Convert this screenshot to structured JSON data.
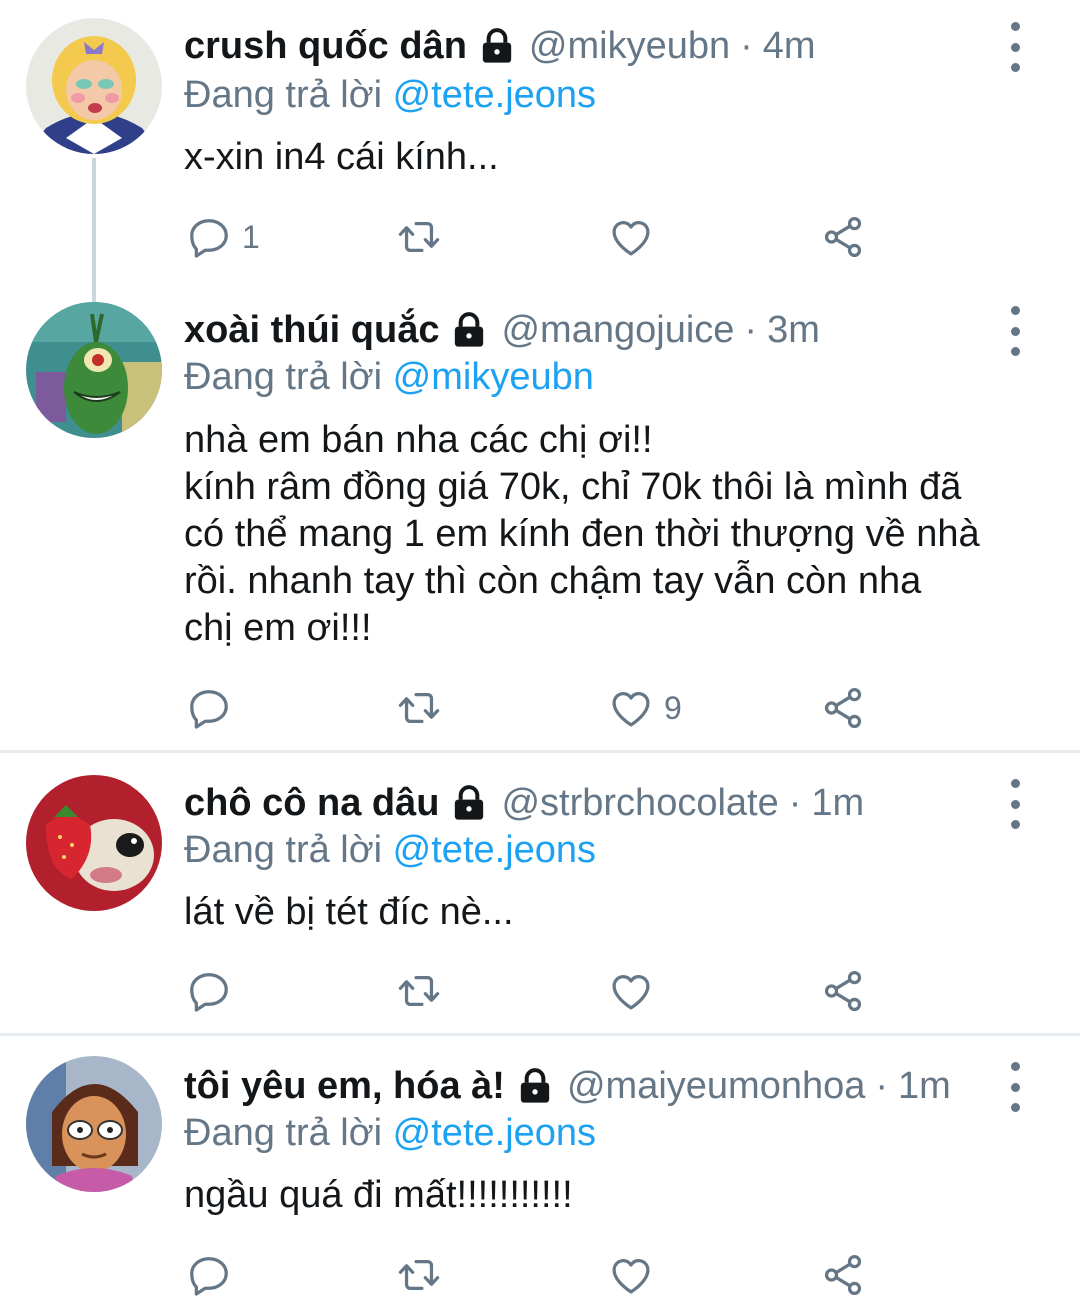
{
  "tweets": [
    {
      "name": "crush quốc dân",
      "handle": "@mikyeubn",
      "separator": "·",
      "time": "4m",
      "replying_prefix": "Đang trả lời ",
      "replying_to": "@tete.jeons",
      "text": "x-xin in4 cái kính...",
      "reply_count": "1",
      "retweet_count": "",
      "like_count": ""
    },
    {
      "name": "xoài thúi quắc",
      "handle": "@mangojuice",
      "separator": "·",
      "time": "3m",
      "replying_prefix": "Đang trả lời ",
      "replying_to": "@mikyeubn",
      "text": "nhà em bán nha các chị ơi!!\nkính râm đồng giá 70k, chỉ 70k thôi là mình đã\ncó thể mang 1 em kính đen thời thượng về nhà\nrồi. nhanh tay thì còn chậm tay vẫn còn nha\nchị em ơi!!!",
      "reply_count": "",
      "retweet_count": "",
      "like_count": "9"
    },
    {
      "name": "chô cô na dâu",
      "handle": "@strbrchocolate",
      "separator": "·",
      "time": "1m",
      "replying_prefix": "Đang trả lời ",
      "replying_to": "@tete.jeons",
      "text": "lát về bị tét đíc nè...",
      "reply_count": "",
      "retweet_count": "",
      "like_count": ""
    },
    {
      "name": "tôi yêu em, hóa à!",
      "handle": "@maiyeumonhoa",
      "separator": "·",
      "time": "1m",
      "replying_prefix": "Đang trả lời ",
      "replying_to": "@tete.jeons",
      "text": "ngầu quá đi mất!!!!!!!!!!!",
      "reply_count": "",
      "retweet_count": "",
      "like_count": ""
    }
  ],
  "icons": {
    "lock": "lock-icon",
    "reply": "reply-icon",
    "retweet": "retweet-icon",
    "like": "heart-icon",
    "share": "share-icon",
    "more": "more-vertical-icon"
  },
  "colors": {
    "text": "#14171a",
    "secondary": "#657786",
    "mention": "#1da1f2",
    "divider": "#e6ecf0",
    "thread_line": "#ccd6dd"
  }
}
